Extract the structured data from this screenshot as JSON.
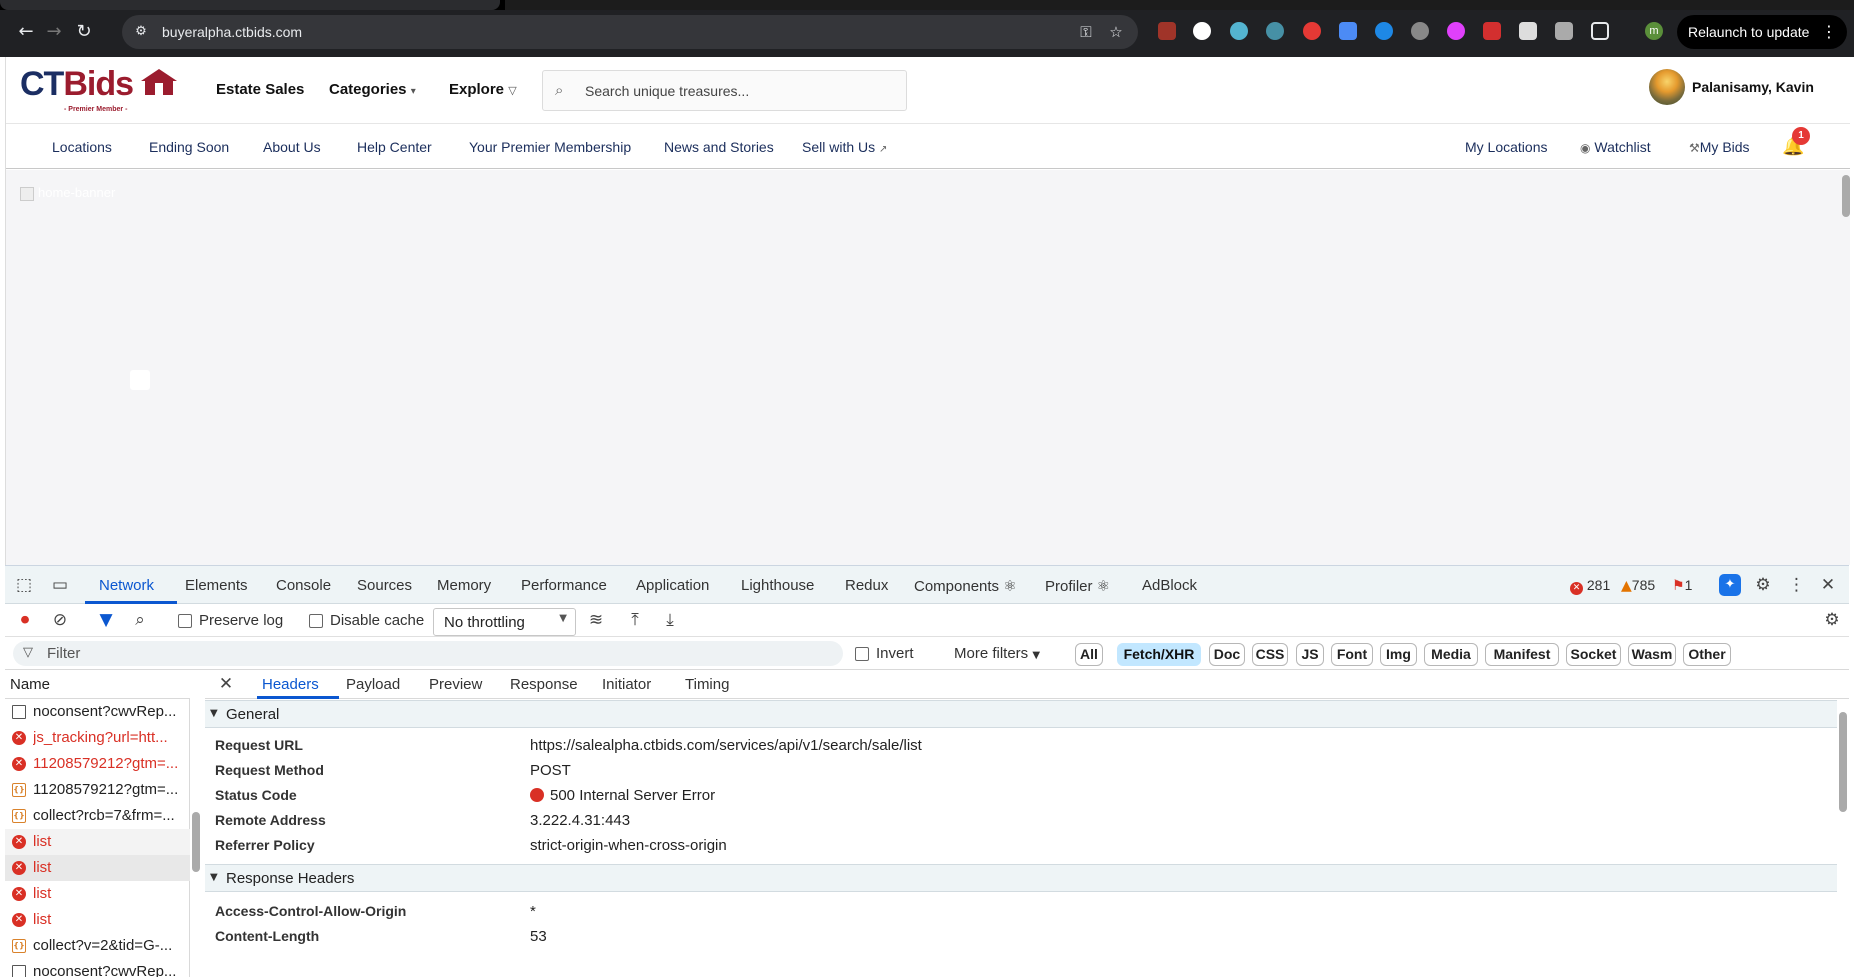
{
  "browser": {
    "url": "buyeralpha.ctbids.com",
    "relaunch_label": "Relaunch to update",
    "profile_initial": "m"
  },
  "site": {
    "logo_text_a": "CT",
    "logo_text_b": "Bids",
    "logo_sub": "- Premier Member -",
    "nav": {
      "estate_sales": "Estate Sales",
      "categories": "Categories",
      "explore": "Explore"
    },
    "search_placeholder": "Search unique treasures...",
    "user_name": "Palanisamy, Kavin",
    "subnav": [
      "Locations",
      "Ending Soon",
      "About Us",
      "Help Center",
      "Your Premier Membership",
      "News and Stories",
      "Sell with Us"
    ],
    "right_links": {
      "my_locations": "My Locations",
      "watchlist": "Watchlist",
      "my_bids": "My Bids"
    },
    "notification_count": "1",
    "banner_alt": "home-banner"
  },
  "devtools": {
    "tabs": [
      "Network",
      "Elements",
      "Console",
      "Sources",
      "Memory",
      "Performance",
      "Application",
      "Lighthouse",
      "Redux",
      "Components ⚛",
      "Profiler ⚛",
      "AdBlock"
    ],
    "errors": "281",
    "warnings": "785",
    "issues": "1",
    "toolbar": {
      "preserve_log": "Preserve log",
      "disable_cache": "Disable cache",
      "throttling": "No throttling"
    },
    "filter": {
      "placeholder": "Filter",
      "invert": "Invert",
      "more_filters": "More filters"
    },
    "type_filters": [
      "All",
      "Fetch/XHR",
      "Doc",
      "CSS",
      "JS",
      "Font",
      "Img",
      "Media",
      "Manifest",
      "Socket",
      "Wasm",
      "Other"
    ],
    "active_type_filter": "Fetch/XHR",
    "list_header": "Name",
    "requests": [
      {
        "name": "noconsent?cwvRep...",
        "status": "doc"
      },
      {
        "name": "js_tracking?url=htt...",
        "status": "error"
      },
      {
        "name": "11208579212?gtm=...",
        "status": "error"
      },
      {
        "name": "11208579212?gtm=...",
        "status": "xhr"
      },
      {
        "name": "collect?rcb=7&frm=...",
        "status": "xhr"
      },
      {
        "name": "list",
        "status": "error"
      },
      {
        "name": "list",
        "status": "error"
      },
      {
        "name": "list",
        "status": "error"
      },
      {
        "name": "list",
        "status": "error"
      },
      {
        "name": "collect?v=2&tid=G-...",
        "status": "xhr"
      },
      {
        "name": "noconsent?cwvRep...",
        "status": "doc"
      }
    ],
    "detail_tabs": [
      "Headers",
      "Payload",
      "Preview",
      "Response",
      "Initiator",
      "Timing"
    ],
    "general_title": "General",
    "general": [
      {
        "k": "Request URL",
        "v": "https://salealpha.ctbids.com/services/api/v1/search/sale/list"
      },
      {
        "k": "Request Method",
        "v": "POST"
      },
      {
        "k": "Status Code",
        "v": "500 Internal Server Error"
      },
      {
        "k": "Remote Address",
        "v": "3.222.4.31:443"
      },
      {
        "k": "Referrer Policy",
        "v": "strict-origin-when-cross-origin"
      }
    ],
    "response_title": "Response Headers",
    "response": [
      {
        "k": "Access-Control-Allow-Origin",
        "v": "*"
      },
      {
        "k": "Content-Length",
        "v": "53"
      }
    ]
  }
}
